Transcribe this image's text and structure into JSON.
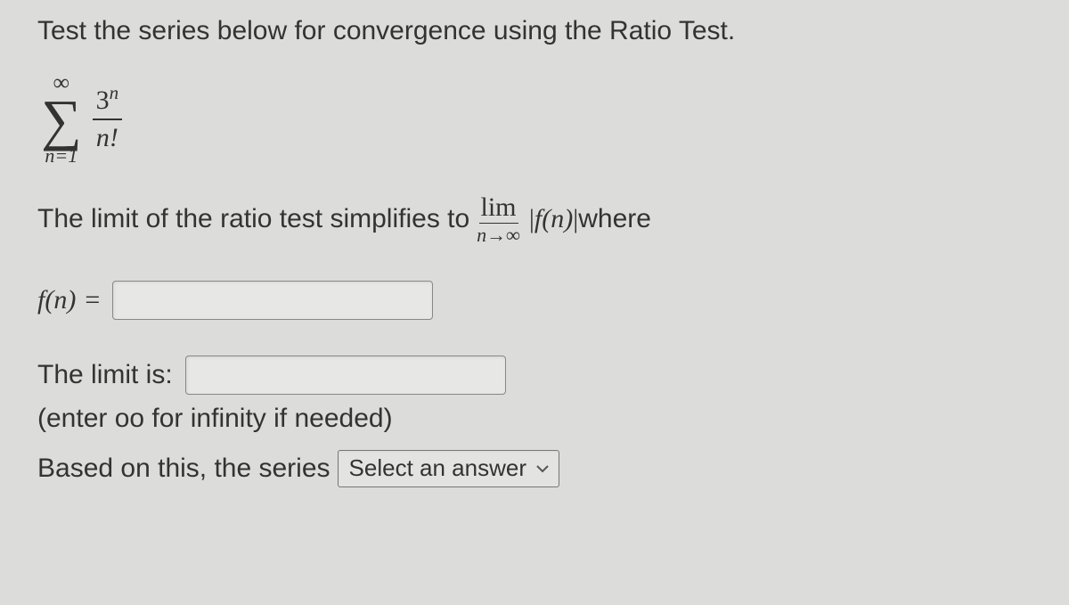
{
  "prompt": "Test the series below for convergence using the Ratio Test.",
  "series": {
    "upper": "∞",
    "lower": "n=1",
    "numerator_base": "3",
    "numerator_exp": "n",
    "denominator": "n!"
  },
  "ratio_sentence": {
    "prefix": "The limit of the ratio test simplifies to ",
    "lim_word": "lim",
    "lim_sub": "n→∞",
    "fn_expr": "f(n)",
    "suffix": " where"
  },
  "fn_input": {
    "label": "f(n)",
    "equals": "="
  },
  "limit_input": {
    "label": "The limit is:"
  },
  "hint": "(enter oo for infinity if needed)",
  "final": {
    "prefix": "Based on this, the series",
    "select_placeholder": "Select an answer"
  }
}
